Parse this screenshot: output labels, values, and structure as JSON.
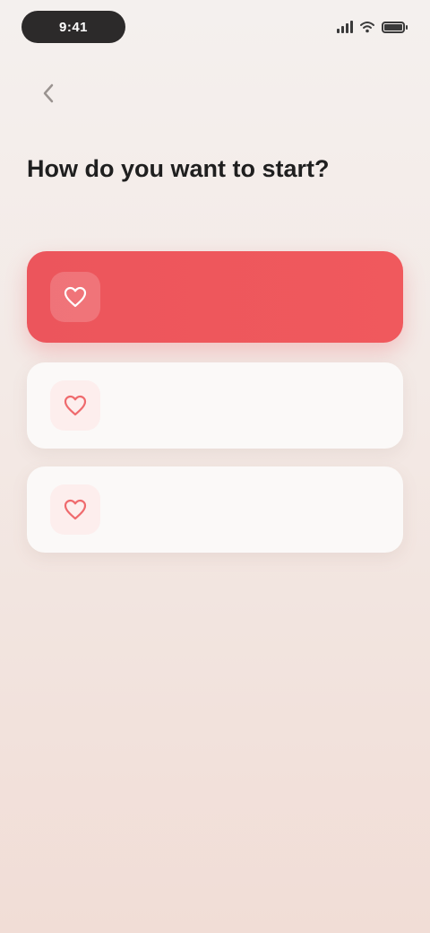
{
  "status_bar": {
    "time": "9:41",
    "icons": [
      "signal-icon",
      "wifi-icon",
      "battery-icon"
    ]
  },
  "nav": {
    "back_icon": "chevron-left-icon"
  },
  "header": {
    "eyebrow": "",
    "title": "How do you want to start?",
    "subtitle": ""
  },
  "options": [
    {
      "icon": "heart-icon",
      "title": "",
      "description": "",
      "tag": "",
      "selected": true
    },
    {
      "icon": "heart-icon",
      "title": "",
      "description": "",
      "tag": "",
      "selected": false
    },
    {
      "icon": "heart-icon",
      "title": "",
      "description": "",
      "tag": "",
      "selected": false
    }
  ],
  "colors": {
    "accent": "#ef5a5e",
    "eyebrow": "#f0a48a",
    "background_top": "#f4f0ee",
    "background_bottom": "#f1ddd6",
    "card": "#fbf9f8"
  }
}
